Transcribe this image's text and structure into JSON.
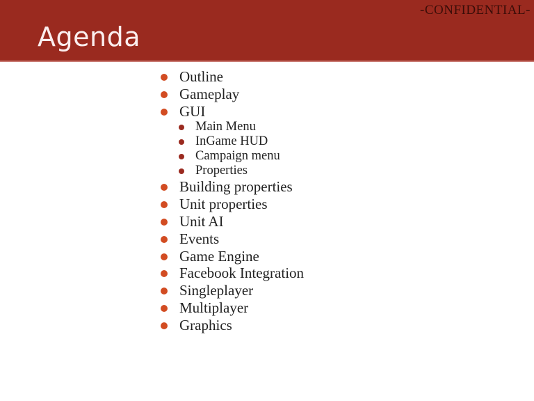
{
  "slide": {
    "title": "Agenda",
    "confidential_label": "-CONFIDENTIAL-",
    "colors": {
      "header": "#9a2a1f",
      "bullet": "#d24c22",
      "sub_bullet": "#9a2a1f"
    }
  },
  "agenda": [
    {
      "label": "Outline",
      "level": 1
    },
    {
      "label": "Gameplay",
      "level": 1
    },
    {
      "label": "GUI",
      "level": 1
    },
    {
      "label": "Main Menu",
      "level": 2
    },
    {
      "label": "InGame HUD",
      "level": 2
    },
    {
      "label": "Campaign menu",
      "level": 2
    },
    {
      "label": "Properties",
      "level": 2
    },
    {
      "label": "Building properties",
      "level": 1
    },
    {
      "label": "Unit properties",
      "level": 1
    },
    {
      "label": "Unit AI",
      "level": 1
    },
    {
      "label": "Events",
      "level": 1
    },
    {
      "label": "Game Engine",
      "level": 1
    },
    {
      "label": "Facebook Integration",
      "level": 1
    },
    {
      "label": "Singleplayer",
      "level": 1
    },
    {
      "label": "Multiplayer",
      "level": 1
    },
    {
      "label": "Graphics",
      "level": 1
    }
  ]
}
